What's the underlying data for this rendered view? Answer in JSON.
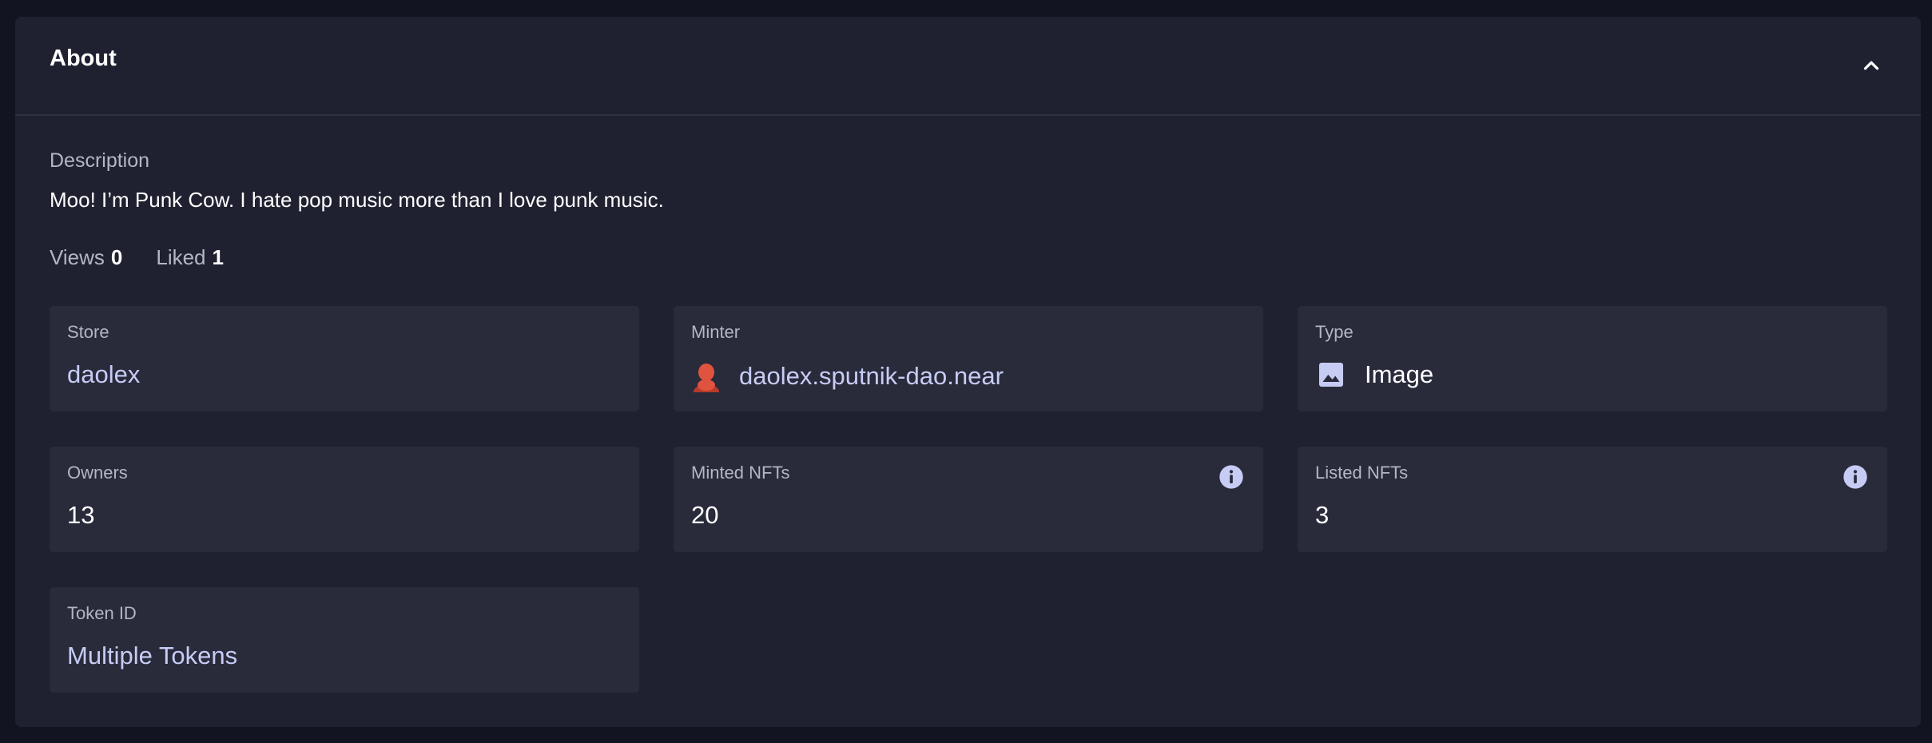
{
  "section": {
    "title": "About",
    "collapse_icon": "chevron-up-icon"
  },
  "description": {
    "label": "Description",
    "text": "Moo! I’m Punk Cow. I hate pop music more than I love punk music."
  },
  "stats": {
    "views_label": "Views",
    "views_value": "0",
    "liked_label": "Liked",
    "liked_value": "1"
  },
  "cards": {
    "store": {
      "label": "Store",
      "value": "daolex"
    },
    "minter": {
      "label": "Minter",
      "value": "daolex.sputnik-dao.near",
      "icon": "avatar-icon"
    },
    "type": {
      "label": "Type",
      "value": "Image",
      "icon": "image-icon"
    },
    "owners": {
      "label": "Owners",
      "value": "13"
    },
    "minted": {
      "label": "Minted NFTs",
      "value": "20",
      "icon": "info-icon"
    },
    "listed": {
      "label": "Listed NFTs",
      "value": "3",
      "icon": "info-icon"
    },
    "token": {
      "label": "Token ID",
      "value": "Multiple Tokens"
    }
  },
  "colors": {
    "background": "#121421",
    "panel": "#1f2130",
    "card": "#292b3b",
    "link": "#c7ccf5",
    "muted_text": "#b4b6c6",
    "avatar": "#e0533f"
  }
}
